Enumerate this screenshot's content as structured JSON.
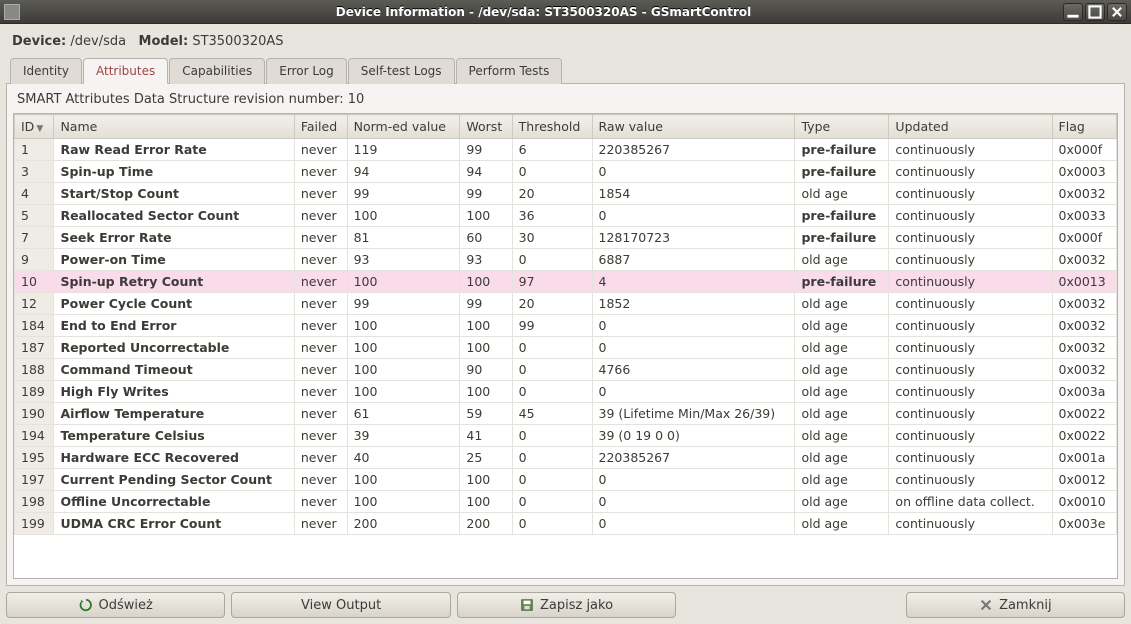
{
  "window": {
    "title": "Device Information - /dev/sda: ST3500320AS - GSmartControl"
  },
  "device_line": {
    "device_label": "Device:",
    "device_value": "/dev/sda",
    "model_label": "Model:",
    "model_value": "ST3500320AS"
  },
  "tabs": {
    "identity": "Identity",
    "attributes": "Attributes",
    "capabilities": "Capabilities",
    "error_log": "Error Log",
    "self_test_logs": "Self-test Logs",
    "perform_tests": "Perform Tests"
  },
  "caption": "SMART Attributes Data Structure revision number: 10",
  "columns": {
    "id": "ID",
    "name": "Name",
    "failed": "Failed",
    "normed": "Norm-ed value",
    "worst": "Worst",
    "threshold": "Threshold",
    "raw": "Raw value",
    "type": "Type",
    "updated": "Updated",
    "flag": "Flag"
  },
  "types": {
    "pre": "pre-failure",
    "old": "old age"
  },
  "upd": {
    "cont": "continuously",
    "off": "on offline data collect."
  },
  "rows": [
    {
      "id": "1",
      "name": "Raw Read Error Rate",
      "failed": "never",
      "normed": "119",
      "worst": "99",
      "thr": "6",
      "raw": "220385267",
      "type": "pre",
      "upd": "cont",
      "flag": "0x000f",
      "hi": false
    },
    {
      "id": "3",
      "name": "Spin-up Time",
      "failed": "never",
      "normed": "94",
      "worst": "94",
      "thr": "0",
      "raw": "0",
      "type": "pre",
      "upd": "cont",
      "flag": "0x0003",
      "hi": false
    },
    {
      "id": "4",
      "name": "Start/Stop Count",
      "failed": "never",
      "normed": "99",
      "worst": "99",
      "thr": "20",
      "raw": "1854",
      "type": "old",
      "upd": "cont",
      "flag": "0x0032",
      "hi": false
    },
    {
      "id": "5",
      "name": "Reallocated Sector Count",
      "failed": "never",
      "normed": "100",
      "worst": "100",
      "thr": "36",
      "raw": "0",
      "type": "pre",
      "upd": "cont",
      "flag": "0x0033",
      "hi": false
    },
    {
      "id": "7",
      "name": "Seek Error Rate",
      "failed": "never",
      "normed": "81",
      "worst": "60",
      "thr": "30",
      "raw": "128170723",
      "type": "pre",
      "upd": "cont",
      "flag": "0x000f",
      "hi": false
    },
    {
      "id": "9",
      "name": "Power-on Time",
      "failed": "never",
      "normed": "93",
      "worst": "93",
      "thr": "0",
      "raw": "6887",
      "type": "old",
      "upd": "cont",
      "flag": "0x0032",
      "hi": false
    },
    {
      "id": "10",
      "name": "Spin-up Retry Count",
      "failed": "never",
      "normed": "100",
      "worst": "100",
      "thr": "97",
      "raw": "4",
      "type": "pre",
      "upd": "cont",
      "flag": "0x0013",
      "hi": true
    },
    {
      "id": "12",
      "name": "Power Cycle Count",
      "failed": "never",
      "normed": "99",
      "worst": "99",
      "thr": "20",
      "raw": "1852",
      "type": "old",
      "upd": "cont",
      "flag": "0x0032",
      "hi": false
    },
    {
      "id": "184",
      "name": "End to End Error",
      "failed": "never",
      "normed": "100",
      "worst": "100",
      "thr": "99",
      "raw": "0",
      "type": "old",
      "upd": "cont",
      "flag": "0x0032",
      "hi": false
    },
    {
      "id": "187",
      "name": "Reported Uncorrectable",
      "failed": "never",
      "normed": "100",
      "worst": "100",
      "thr": "0",
      "raw": "0",
      "type": "old",
      "upd": "cont",
      "flag": "0x0032",
      "hi": false
    },
    {
      "id": "188",
      "name": "Command Timeout",
      "failed": "never",
      "normed": "100",
      "worst": "90",
      "thr": "0",
      "raw": "4766",
      "type": "old",
      "upd": "cont",
      "flag": "0x0032",
      "hi": false
    },
    {
      "id": "189",
      "name": "High Fly Writes",
      "failed": "never",
      "normed": "100",
      "worst": "100",
      "thr": "0",
      "raw": "0",
      "type": "old",
      "upd": "cont",
      "flag": "0x003a",
      "hi": false
    },
    {
      "id": "190",
      "name": "Airflow Temperature",
      "failed": "never",
      "normed": "61",
      "worst": "59",
      "thr": "45",
      "raw": "39 (Lifetime Min/Max 26/39)",
      "type": "old",
      "upd": "cont",
      "flag": "0x0022",
      "hi": false
    },
    {
      "id": "194",
      "name": "Temperature Celsius",
      "failed": "never",
      "normed": "39",
      "worst": "41",
      "thr": "0",
      "raw": "39 (0 19 0 0)",
      "type": "old",
      "upd": "cont",
      "flag": "0x0022",
      "hi": false
    },
    {
      "id": "195",
      "name": "Hardware ECC Recovered",
      "failed": "never",
      "normed": "40",
      "worst": "25",
      "thr": "0",
      "raw": "220385267",
      "type": "old",
      "upd": "cont",
      "flag": "0x001a",
      "hi": false
    },
    {
      "id": "197",
      "name": "Current Pending Sector Count",
      "failed": "never",
      "normed": "100",
      "worst": "100",
      "thr": "0",
      "raw": "0",
      "type": "old",
      "upd": "cont",
      "flag": "0x0012",
      "hi": false
    },
    {
      "id": "198",
      "name": "Offline Uncorrectable",
      "failed": "never",
      "normed": "100",
      "worst": "100",
      "thr": "0",
      "raw": "0",
      "type": "old",
      "upd": "off",
      "flag": "0x0010",
      "hi": false
    },
    {
      "id": "199",
      "name": "UDMA CRC Error Count",
      "failed": "never",
      "normed": "200",
      "worst": "200",
      "thr": "0",
      "raw": "0",
      "type": "old",
      "upd": "cont",
      "flag": "0x003e",
      "hi": false
    }
  ],
  "buttons": {
    "refresh": "Odśwież",
    "view_output": "View Output",
    "save_as": "Zapisz jako",
    "close": "Zamknij"
  }
}
